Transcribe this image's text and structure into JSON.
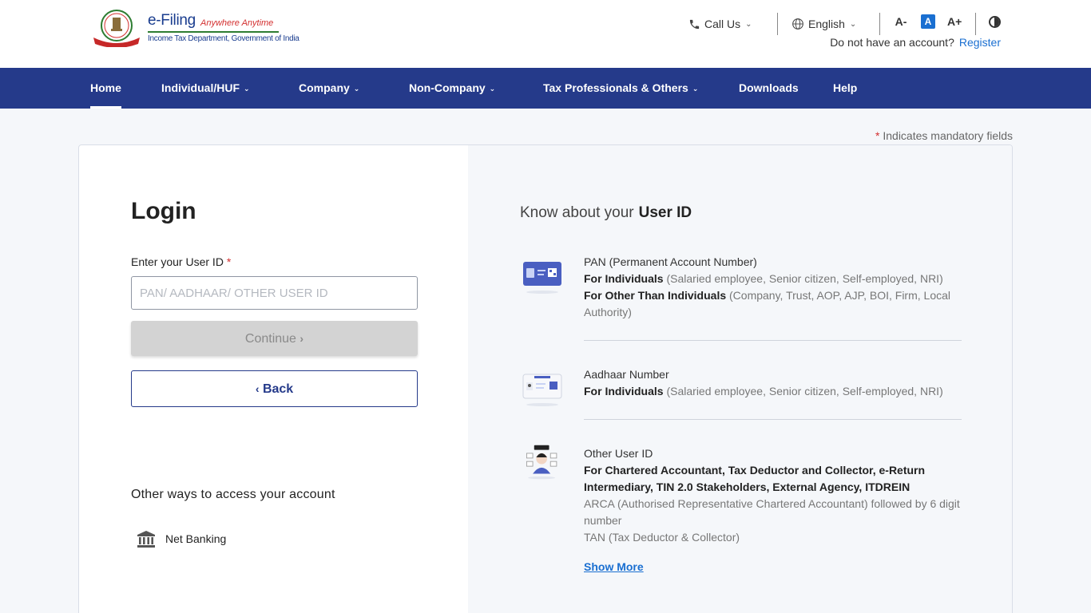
{
  "header": {
    "brand": "e-Filing",
    "tagline": "Anywhere Anytime",
    "department": "Income Tax Department, Government of India",
    "call_us": "Call Us",
    "language": "English",
    "font_decrease": "A-",
    "font_normal": "A",
    "font_increase": "A+",
    "no_account_text": "Do not have an account?",
    "register_label": "Register"
  },
  "nav": {
    "items": [
      {
        "label": "Home",
        "active": true,
        "dropdown": false
      },
      {
        "label": "Individual/HUF",
        "dropdown": true
      },
      {
        "label": "Company",
        "dropdown": true
      },
      {
        "label": "Non-Company",
        "dropdown": true
      },
      {
        "label": "Tax Professionals & Others",
        "dropdown": true
      },
      {
        "label": "Downloads",
        "dropdown": false
      },
      {
        "label": "Help",
        "dropdown": false
      }
    ]
  },
  "mandatory_note": {
    "star": "*",
    "text": "Indicates mandatory fields"
  },
  "login": {
    "title": "Login",
    "field_label": "Enter your User ID",
    "required_star": "*",
    "input_value": "",
    "input_placeholder": "PAN/ AADHAAR/ OTHER USER ID",
    "continue_label": "Continue",
    "back_label": "Back",
    "other_ways_title": "Other ways to access your account",
    "net_banking_label": "Net Banking"
  },
  "know": {
    "title_prefix": "Know about your",
    "title_bold": "User ID",
    "items": [
      {
        "head": "PAN (Permanent Account Number)",
        "line1_bold": "For Individuals",
        "line1_rest": "(Salaried employee, Senior citizen, Self-employed, NRI)",
        "line2_bold": "For Other Than Individuals",
        "line2_rest": "(Company, Trust, AOP, AJP, BOI, Firm, Local Authority)"
      },
      {
        "head": "Aadhaar Number",
        "line1_bold": "For Individuals",
        "line1_rest": "(Salaried employee, Senior citizen, Self-employed, NRI)"
      },
      {
        "head": "Other User ID",
        "line1_bold": "For Chartered Accountant, Tax Deductor and Collector, e-Return Intermediary, TIN 2.0 Stakeholders, External Agency, ITDREIN",
        "line2": "ARCA (Authorised Representative Chartered Accountant) followed by 6 digit number",
        "line3": "TAN (Tax Deductor & Collector)"
      }
    ],
    "show_more_label": "Show More"
  },
  "colors": {
    "nav_bg": "#253a8a",
    "link": "#1a6fd1",
    "required": "#d32f2f",
    "panel_bg": "#f5f7fa"
  }
}
